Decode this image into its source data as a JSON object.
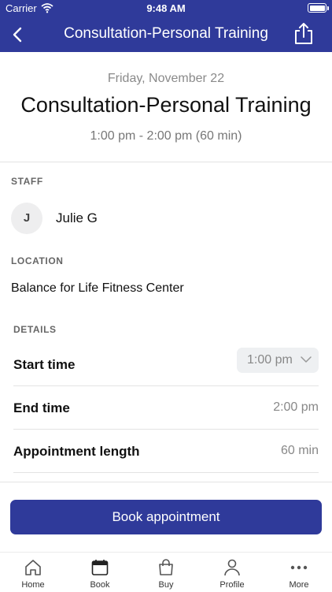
{
  "status_bar": {
    "carrier": "Carrier",
    "time": "9:48 AM"
  },
  "nav": {
    "title": "Consultation-Personal Training",
    "back_icon": "chevron-left-icon",
    "share_icon": "share-icon"
  },
  "appointment": {
    "date": "Friday, November 22",
    "title": "Consultation-Personal Training",
    "time_range": "1:00 pm - 2:00 pm (60 min)"
  },
  "staff": {
    "section_label": "STAFF",
    "initial": "J",
    "name": "Julie G"
  },
  "location": {
    "section_label": "LOCATION",
    "name": "Balance for Life Fitness Center"
  },
  "details": {
    "section_label": "DETAILS",
    "start_time_label": "Start time",
    "start_time_value": "1:00 pm",
    "end_time_label": "End time",
    "end_time_value": "2:00 pm",
    "length_label": "Appointment length",
    "length_value": "60 min"
  },
  "book_button": "Book appointment",
  "tabs": [
    {
      "label": "Home",
      "icon": "home-icon"
    },
    {
      "label": "Book",
      "icon": "calendar-icon"
    },
    {
      "label": "Buy",
      "icon": "shopping-bag-icon"
    },
    {
      "label": "Profile",
      "icon": "person-icon"
    },
    {
      "label": "More",
      "icon": "more-dots-icon"
    }
  ],
  "colors": {
    "brand": "#2f3a9a",
    "muted_text": "#888888"
  }
}
